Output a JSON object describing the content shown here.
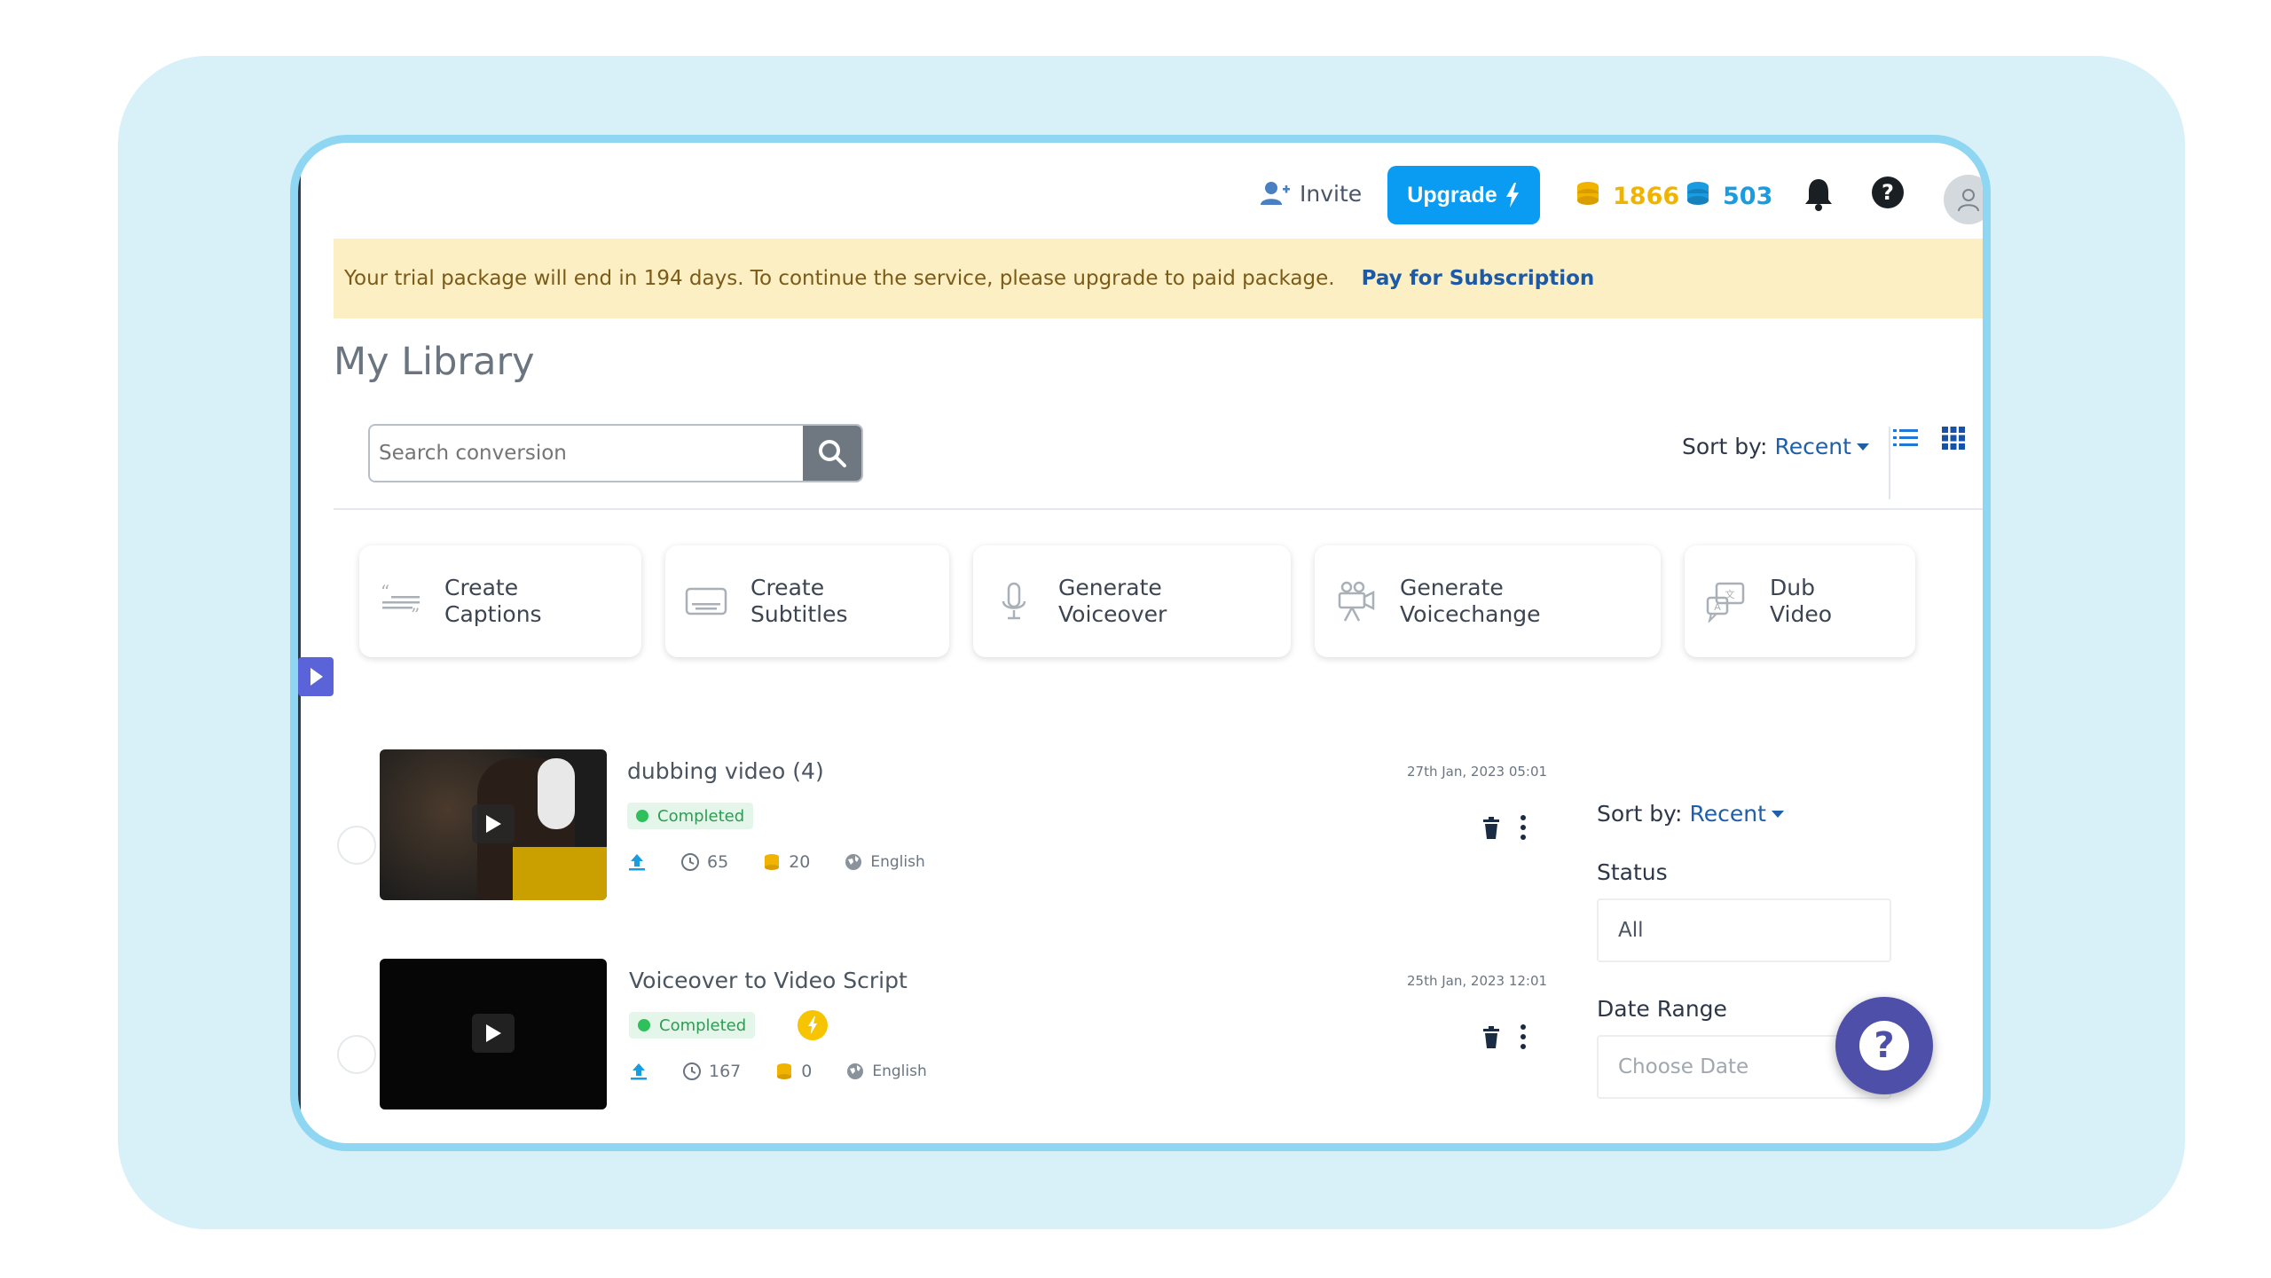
{
  "topbar": {
    "invite_label": "Invite",
    "upgrade_label": "Upgrade",
    "gold_credits": "1866",
    "blue_credits": "503",
    "colors": {
      "upgrade_bg": "#0a9cf2",
      "gold": "#f0b400",
      "blue": "#1c9ce0"
    }
  },
  "banner": {
    "message": "Your trial package will end in 194 days. To continue the service, please upgrade to paid package.",
    "link_label": "Pay for Subscription"
  },
  "library": {
    "title": "My Library",
    "search_placeholder": "Search conversion",
    "sort_label": "Sort by:",
    "sort_value": "Recent"
  },
  "actions": [
    {
      "line1": "Create",
      "line2": "Captions",
      "icon": "captions-icon"
    },
    {
      "line1": "Create",
      "line2": "Subtitles",
      "icon": "subtitles-icon"
    },
    {
      "line1": "Generate",
      "line2": "Voiceover",
      "icon": "microphone-icon"
    },
    {
      "line1": "Generate",
      "line2": "Voicechange",
      "icon": "video-camera-icon"
    },
    {
      "line1": "Dub",
      "line2": "Video",
      "icon": "dub-video-icon"
    }
  ],
  "items": [
    {
      "title": "dubbing video (4)",
      "status": "Completed",
      "date": "27th Jan, 2023 05:01",
      "duration": "65",
      "credits": "20",
      "language": "English"
    },
    {
      "title": "Voiceover to Video Script",
      "status": "Completed",
      "date": "25th Jan, 2023 12:01",
      "duration": "167",
      "credits": "0",
      "language": "English"
    }
  ],
  "filters": {
    "sort_label": "Sort by:",
    "sort_value": "Recent",
    "status_label": "Status",
    "status_value": "All",
    "date_label": "Date Range",
    "date_placeholder": "Choose Date"
  },
  "help_fab": "?"
}
